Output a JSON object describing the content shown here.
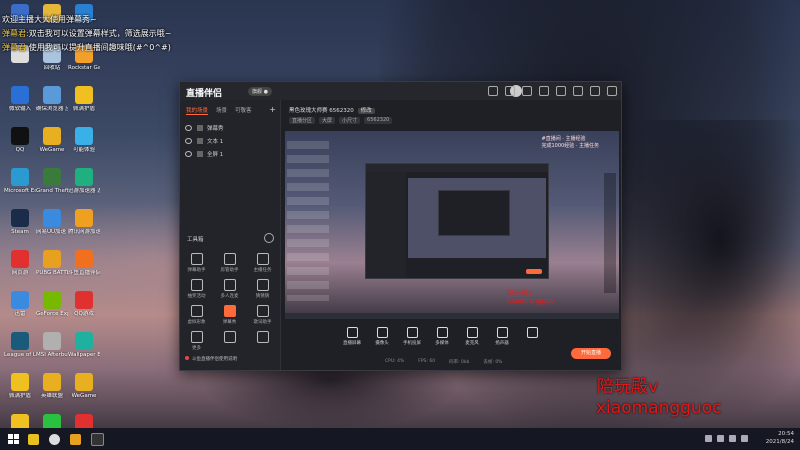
{
  "danmaku": [
    {
      "name": "",
      "text": "欢迎主播大大使用弹幕秀~"
    },
    {
      "name": "弹幕君:",
      "text": "双击我可以设置弹幕样式，筛选展示哦~"
    },
    {
      "name": "弹幕君:",
      "text": "使用我可以提升直播间趣味哦(#^0^#)"
    }
  ],
  "desktop_icons": [
    {
      "label": "",
      "color": "#3a6cc8"
    },
    {
      "label": "",
      "color": "#e4b63a"
    },
    {
      "label": "",
      "color": "#2a80d0"
    },
    {
      "label": "",
      "color": "#ddd"
    },
    {
      "label": "回收站",
      "color": "#aac4e0"
    },
    {
      "label": "Rockstar Games...",
      "color": "#f2a02a"
    },
    {
      "label": "微软输入",
      "color": "#2a6fd6"
    },
    {
      "label": "确保浏览器 应启动",
      "color": "#5a9ad8"
    },
    {
      "label": "佩满护盾",
      "color": "#f0c020"
    },
    {
      "label": "QQ",
      "color": "#111"
    },
    {
      "label": "WeGame",
      "color": "#e8b020"
    },
    {
      "label": "可能体验",
      "color": "#3ab0e8"
    },
    {
      "label": "Microsoft Edge",
      "color": "#2a9ad0"
    },
    {
      "label": "Grand Theft Auto V",
      "color": "#3a7a3a"
    },
    {
      "label": "迅游加速器 游戏",
      "color": "#20b080"
    },
    {
      "label": "Steam",
      "color": "#1a2c4a"
    },
    {
      "label": "网易UU加速 游戏",
      "color": "#3a8ae0"
    },
    {
      "label": "腾讯网游加速器",
      "color": "#f0a020"
    },
    {
      "label": "网页游",
      "color": "#e03030"
    },
    {
      "label": "PUBG BATTLEGR...",
      "color": "#e8a020"
    },
    {
      "label": "斗鱼直播伴侣",
      "color": "#f07020"
    },
    {
      "label": "迅雷",
      "color": "#3a8ae0"
    },
    {
      "label": "GeForce Experience",
      "color": "#76b900"
    },
    {
      "label": "QQ游戏",
      "color": "#e03030"
    },
    {
      "label": "League of Legends",
      "color": "#1a5a7a"
    },
    {
      "label": "MSI Afterburner",
      "color": "#b0b0b0"
    },
    {
      "label": "Wallpaper Engine",
      "color": "#20b0a0"
    },
    {
      "label": "佩满护盾",
      "color": "#f0c020"
    },
    {
      "label": "英雄联盟",
      "color": "#e8b020"
    },
    {
      "label": "WeGame",
      "color": "#e8b020"
    },
    {
      "label": "QQ音乐",
      "color": "#f0c020"
    },
    {
      "label": "微信",
      "color": "#2ac040"
    },
    {
      "label": "火绒安全",
      "color": "#e03030"
    }
  ],
  "window": {
    "title": "直播伴侣",
    "version": "旗舰 ●",
    "tabs": [
      "我的场景",
      "场景",
      "可敬客"
    ],
    "scenes": [
      "弹幕秀",
      "文本 1",
      "全屏 1"
    ],
    "toolbox_title": "工具箱",
    "tools": [
      {
        "label": "弹幕助手"
      },
      {
        "label": "房管助手"
      },
      {
        "label": "主播任务"
      },
      {
        "label": "抽奖活动"
      },
      {
        "label": "多人连麦"
      },
      {
        "label": "猜猜猜"
      },
      {
        "label": "虚拟形象"
      },
      {
        "label": "弹幕秀"
      },
      {
        "label": "歌词助手"
      },
      {
        "label": "更多"
      },
      {
        "label": ""
      },
      {
        "label": ""
      }
    ],
    "notice": "斗鱼直播伴侣使用说明",
    "room_title": "黑色玫瑰大师赛 6562320",
    "room_tag": "修改",
    "room_chips": [
      "直播分区",
      "大屏",
      "小尺寸",
      "6562320"
    ],
    "preview_ad": "#直播间 · 主播经验",
    "preview_ad2": "完成1000经验 · 主播任务",
    "preview_watermark": [
      "陪玩殿v",
      "xiaomangguo"
    ],
    "controls": [
      "直播屏幕",
      "摄像头",
      "手机投屏",
      "多媒体",
      "麦克风",
      "扬声器",
      ""
    ],
    "live_button": "开始直播",
    "status": [
      "CPU: 4%",
      "FPS: 60",
      "码率: 0kb",
      "丢帧: 0%"
    ]
  },
  "overlay": {
    "line1": "陪玩殿v",
    "line2": "xiaomangguoc"
  },
  "taskbar": {
    "time": "20:54",
    "date": "2021/8/24"
  }
}
